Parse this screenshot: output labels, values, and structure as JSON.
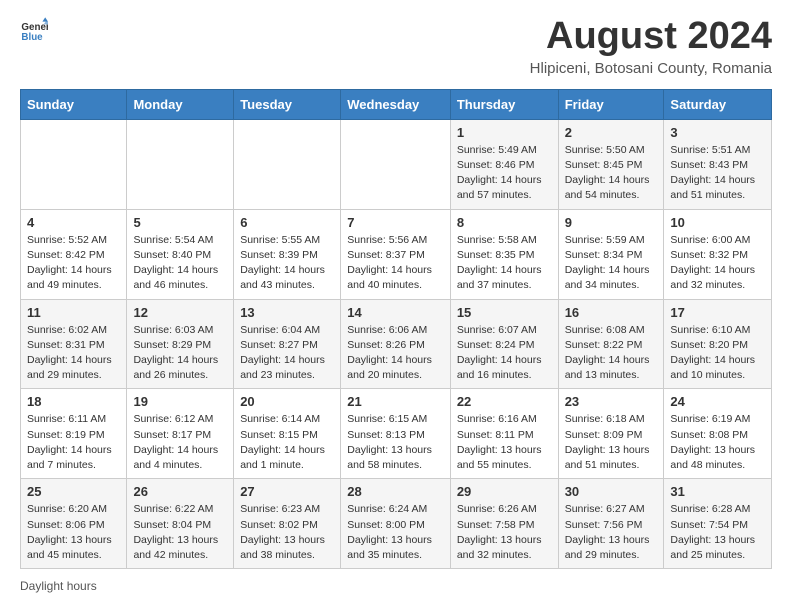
{
  "header": {
    "logo_general": "General",
    "logo_blue": "Blue",
    "title": "August 2024",
    "subtitle": "Hlipiceni, Botosani County, Romania"
  },
  "calendar": {
    "days_of_week": [
      "Sunday",
      "Monday",
      "Tuesday",
      "Wednesday",
      "Thursday",
      "Friday",
      "Saturday"
    ],
    "weeks": [
      [
        {
          "day": "",
          "info": ""
        },
        {
          "day": "",
          "info": ""
        },
        {
          "day": "",
          "info": ""
        },
        {
          "day": "",
          "info": ""
        },
        {
          "day": "1",
          "info": "Sunrise: 5:49 AM\nSunset: 8:46 PM\nDaylight: 14 hours\nand 57 minutes."
        },
        {
          "day": "2",
          "info": "Sunrise: 5:50 AM\nSunset: 8:45 PM\nDaylight: 14 hours\nand 54 minutes."
        },
        {
          "day": "3",
          "info": "Sunrise: 5:51 AM\nSunset: 8:43 PM\nDaylight: 14 hours\nand 51 minutes."
        }
      ],
      [
        {
          "day": "4",
          "info": "Sunrise: 5:52 AM\nSunset: 8:42 PM\nDaylight: 14 hours\nand 49 minutes."
        },
        {
          "day": "5",
          "info": "Sunrise: 5:54 AM\nSunset: 8:40 PM\nDaylight: 14 hours\nand 46 minutes."
        },
        {
          "day": "6",
          "info": "Sunrise: 5:55 AM\nSunset: 8:39 PM\nDaylight: 14 hours\nand 43 minutes."
        },
        {
          "day": "7",
          "info": "Sunrise: 5:56 AM\nSunset: 8:37 PM\nDaylight: 14 hours\nand 40 minutes."
        },
        {
          "day": "8",
          "info": "Sunrise: 5:58 AM\nSunset: 8:35 PM\nDaylight: 14 hours\nand 37 minutes."
        },
        {
          "day": "9",
          "info": "Sunrise: 5:59 AM\nSunset: 8:34 PM\nDaylight: 14 hours\nand 34 minutes."
        },
        {
          "day": "10",
          "info": "Sunrise: 6:00 AM\nSunset: 8:32 PM\nDaylight: 14 hours\nand 32 minutes."
        }
      ],
      [
        {
          "day": "11",
          "info": "Sunrise: 6:02 AM\nSunset: 8:31 PM\nDaylight: 14 hours\nand 29 minutes."
        },
        {
          "day": "12",
          "info": "Sunrise: 6:03 AM\nSunset: 8:29 PM\nDaylight: 14 hours\nand 26 minutes."
        },
        {
          "day": "13",
          "info": "Sunrise: 6:04 AM\nSunset: 8:27 PM\nDaylight: 14 hours\nand 23 minutes."
        },
        {
          "day": "14",
          "info": "Sunrise: 6:06 AM\nSunset: 8:26 PM\nDaylight: 14 hours\nand 20 minutes."
        },
        {
          "day": "15",
          "info": "Sunrise: 6:07 AM\nSunset: 8:24 PM\nDaylight: 14 hours\nand 16 minutes."
        },
        {
          "day": "16",
          "info": "Sunrise: 6:08 AM\nSunset: 8:22 PM\nDaylight: 14 hours\nand 13 minutes."
        },
        {
          "day": "17",
          "info": "Sunrise: 6:10 AM\nSunset: 8:20 PM\nDaylight: 14 hours\nand 10 minutes."
        }
      ],
      [
        {
          "day": "18",
          "info": "Sunrise: 6:11 AM\nSunset: 8:19 PM\nDaylight: 14 hours\nand 7 minutes."
        },
        {
          "day": "19",
          "info": "Sunrise: 6:12 AM\nSunset: 8:17 PM\nDaylight: 14 hours\nand 4 minutes."
        },
        {
          "day": "20",
          "info": "Sunrise: 6:14 AM\nSunset: 8:15 PM\nDaylight: 14 hours\nand 1 minute."
        },
        {
          "day": "21",
          "info": "Sunrise: 6:15 AM\nSunset: 8:13 PM\nDaylight: 13 hours\nand 58 minutes."
        },
        {
          "day": "22",
          "info": "Sunrise: 6:16 AM\nSunset: 8:11 PM\nDaylight: 13 hours\nand 55 minutes."
        },
        {
          "day": "23",
          "info": "Sunrise: 6:18 AM\nSunset: 8:09 PM\nDaylight: 13 hours\nand 51 minutes."
        },
        {
          "day": "24",
          "info": "Sunrise: 6:19 AM\nSunset: 8:08 PM\nDaylight: 13 hours\nand 48 minutes."
        }
      ],
      [
        {
          "day": "25",
          "info": "Sunrise: 6:20 AM\nSunset: 8:06 PM\nDaylight: 13 hours\nand 45 minutes."
        },
        {
          "day": "26",
          "info": "Sunrise: 6:22 AM\nSunset: 8:04 PM\nDaylight: 13 hours\nand 42 minutes."
        },
        {
          "day": "27",
          "info": "Sunrise: 6:23 AM\nSunset: 8:02 PM\nDaylight: 13 hours\nand 38 minutes."
        },
        {
          "day": "28",
          "info": "Sunrise: 6:24 AM\nSunset: 8:00 PM\nDaylight: 13 hours\nand 35 minutes."
        },
        {
          "day": "29",
          "info": "Sunrise: 6:26 AM\nSunset: 7:58 PM\nDaylight: 13 hours\nand 32 minutes."
        },
        {
          "day": "30",
          "info": "Sunrise: 6:27 AM\nSunset: 7:56 PM\nDaylight: 13 hours\nand 29 minutes."
        },
        {
          "day": "31",
          "info": "Sunrise: 6:28 AM\nSunset: 7:54 PM\nDaylight: 13 hours\nand 25 minutes."
        }
      ]
    ]
  },
  "footer": {
    "note": "Daylight hours"
  }
}
